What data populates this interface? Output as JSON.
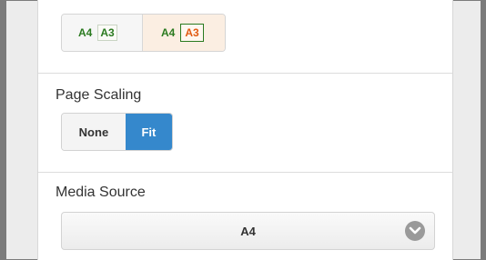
{
  "paper_size": {
    "option_a": {
      "left_label": "A4",
      "right_label": "A3"
    },
    "option_b": {
      "left_label": "A4",
      "right_label": "A3"
    }
  },
  "page_scaling": {
    "title": "Page Scaling",
    "options": [
      "None",
      "Fit"
    ],
    "selected": "Fit"
  },
  "media_source": {
    "title": "Media Source",
    "value": "A4",
    "icon": "chevron-down-icon"
  },
  "colors": {
    "accent": "#3588cc",
    "paper_label_green": "#2a7a1f",
    "paper_label_orange": "#e25a12",
    "selected_paper_bg": "#fbeee2"
  }
}
